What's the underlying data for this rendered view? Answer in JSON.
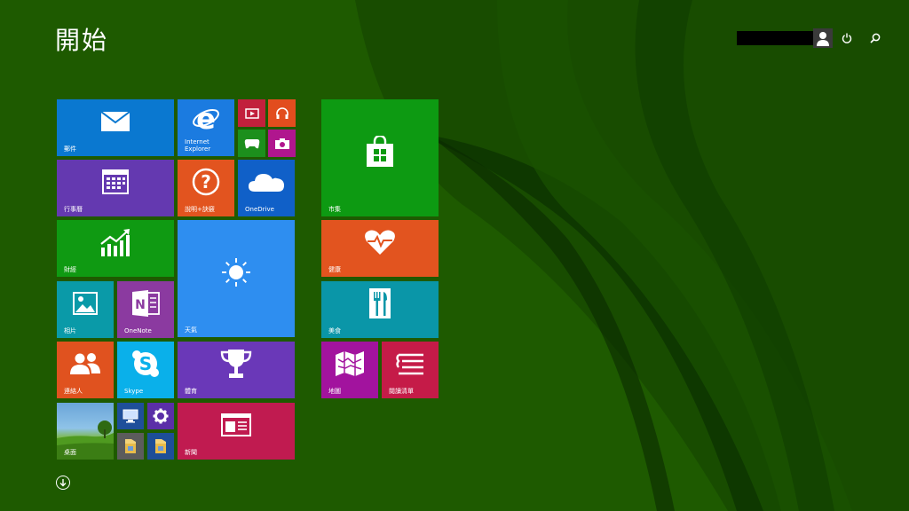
{
  "screen": {
    "title": "開始"
  },
  "topbar": {
    "power_icon": "power-icon",
    "search_icon": "search-icon",
    "avatar_icon": "user-avatar-icon"
  },
  "tiles": {
    "mail": {
      "label": "郵件",
      "color": "#0a78d0"
    },
    "ie": {
      "label": "Internet\nExplorer",
      "color": "#1b7be0"
    },
    "video": {
      "label": "",
      "color": "#c2203c"
    },
    "music": {
      "label": "",
      "color": "#e24d1e"
    },
    "games": {
      "label": "",
      "color": "#1c8f1c"
    },
    "camera": {
      "label": "",
      "color": "#b0168e"
    },
    "calendar": {
      "label": "行事曆",
      "color": "#6439b0"
    },
    "help": {
      "label": "說明+訣竅",
      "color": "#e2541f"
    },
    "onedrive": {
      "label": "OneDrive",
      "color": "#1060c8"
    },
    "finance": {
      "label": "財經",
      "color": "#0f9a12"
    },
    "weather": {
      "label": "天氣",
      "color": "#2e8ef0"
    },
    "photos": {
      "label": "相片",
      "color": "#0a9aa8"
    },
    "onenote": {
      "label": "OneNote",
      "color": "#8b3aa0"
    },
    "people": {
      "label": "連絡人",
      "color": "#e0521f"
    },
    "skype": {
      "label": "Skype",
      "color": "#0ab0ea"
    },
    "sports": {
      "label": "體育",
      "color": "#6a38b8"
    },
    "desktop": {
      "label": "桌面"
    },
    "thispc": {
      "label": "",
      "color": "#1f4f9a"
    },
    "settings": {
      "label": "",
      "color": "#5b2fa8"
    },
    "fileexp1": {
      "label": "",
      "color": "#5c5c5c"
    },
    "fileexp2": {
      "label": "",
      "color": "#1d4e98"
    },
    "news": {
      "label": "新聞",
      "color": "#c01b50"
    },
    "store": {
      "label": "市集",
      "color": "#0d9a12"
    },
    "health": {
      "label": "健康",
      "color": "#e2541f"
    },
    "food": {
      "label": "美食",
      "color": "#0a96a8"
    },
    "maps": {
      "label": "地圖",
      "color": "#a2139e"
    },
    "reading": {
      "label": "閱讀清單",
      "color": "#c51b48"
    }
  },
  "background": {
    "base": "#1e5a00"
  }
}
